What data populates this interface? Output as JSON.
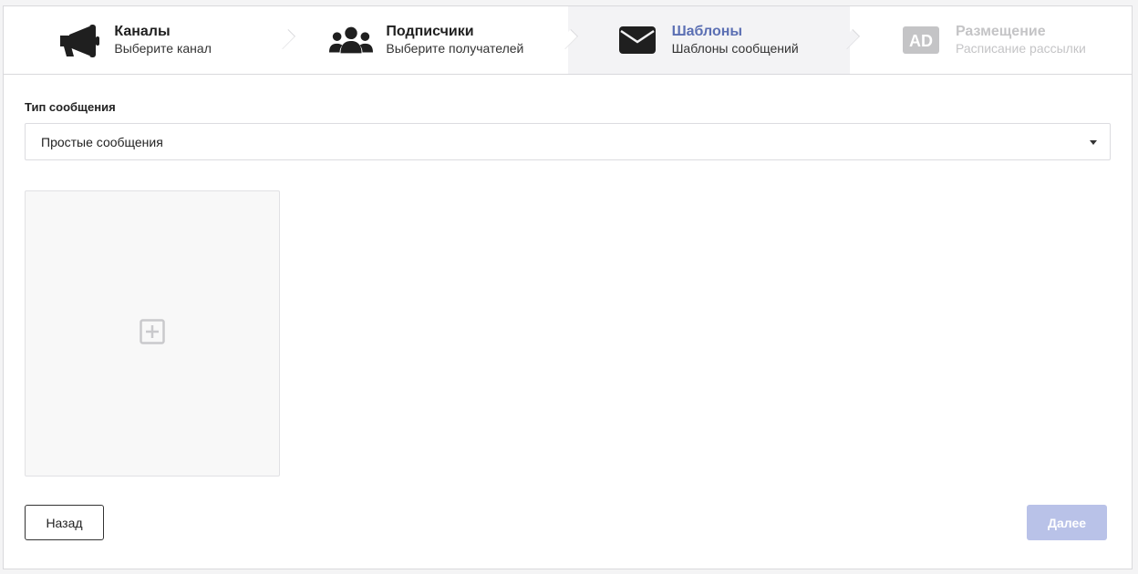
{
  "steps": [
    {
      "title": "Каналы",
      "subtitle": "Выберите канал",
      "icon": "megaphone-icon",
      "state": "done"
    },
    {
      "title": "Подписчики",
      "subtitle": "Выберите получателей",
      "icon": "users-icon",
      "state": "done"
    },
    {
      "title": "Шаблоны",
      "subtitle": "Шаблоны сообщений",
      "icon": "envelope-icon",
      "state": "active"
    },
    {
      "title": "Размещение",
      "subtitle": "Расписание рассылки",
      "icon": "ad-icon",
      "icon_text": "AD",
      "state": "disabled"
    }
  ],
  "form": {
    "message_type_label": "Тип сообщения",
    "message_type_value": "Простые сообщения"
  },
  "templates": {
    "add_icon": "plus-square-icon"
  },
  "footer": {
    "back_label": "Назад",
    "next_label": "Далее"
  },
  "colors": {
    "accent": "#5b6fb3",
    "next_disabled_bg": "#b9c2e8",
    "disabled_text": "#c4c4c6"
  }
}
